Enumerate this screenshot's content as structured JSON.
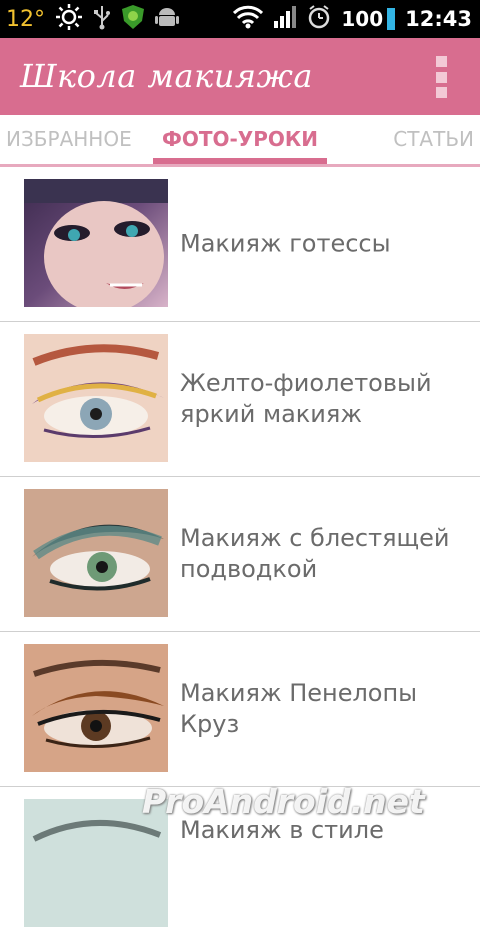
{
  "status_bar": {
    "temperature": "12°",
    "battery": "100",
    "time": "12:43",
    "icons": [
      "sun-icon",
      "usb-icon",
      "shield-app-icon",
      "android-icon",
      "wifi-icon",
      "signal-icon",
      "alarm-icon",
      "battery-icon"
    ]
  },
  "app": {
    "title": "Школа макияжа",
    "bar_color": "#d86d8f",
    "overflow_icon": "overflow-menu-icon"
  },
  "tabs": {
    "favorites": "ИЗБРАННОЕ",
    "photo_lessons": "ФОТО-УРОКИ",
    "articles": "СТАТЬИ",
    "selected": "ФОТО-УРОКИ"
  },
  "lessons": [
    {
      "title": "Макияж готессы"
    },
    {
      "title": "Желто-фиолетовый яркий макияж"
    },
    {
      "title": "Макияж с блестящей подводкой"
    },
    {
      "title": "Макияж Пенелопы Круз"
    },
    {
      "title": "Макияж в стиле"
    }
  ],
  "watermark": "ProAndroid.net"
}
